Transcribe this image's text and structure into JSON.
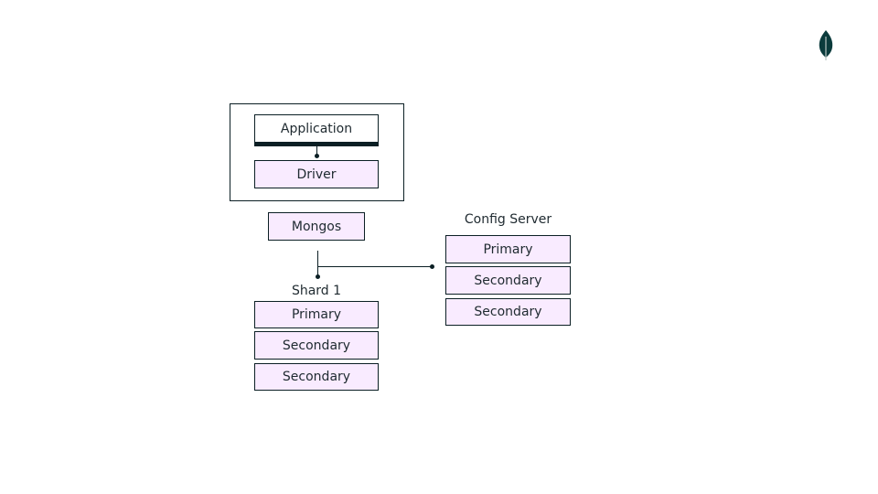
{
  "logo": {
    "icon": "leaf-icon",
    "color": "#0b3b3c"
  },
  "client": {
    "application_label": "Application",
    "driver_label": "Driver"
  },
  "router": {
    "mongos_label": "Mongos"
  },
  "config_server": {
    "title": "Config Server",
    "members": [
      "Primary",
      "Secondary",
      "Secondary"
    ]
  },
  "shard": {
    "title": "Shard 1",
    "members": [
      "Primary",
      "Secondary",
      "Secondary"
    ]
  },
  "colors": {
    "node_fill": "#f9ebff",
    "line": "#0b1f24",
    "text": "#1f2a30"
  }
}
